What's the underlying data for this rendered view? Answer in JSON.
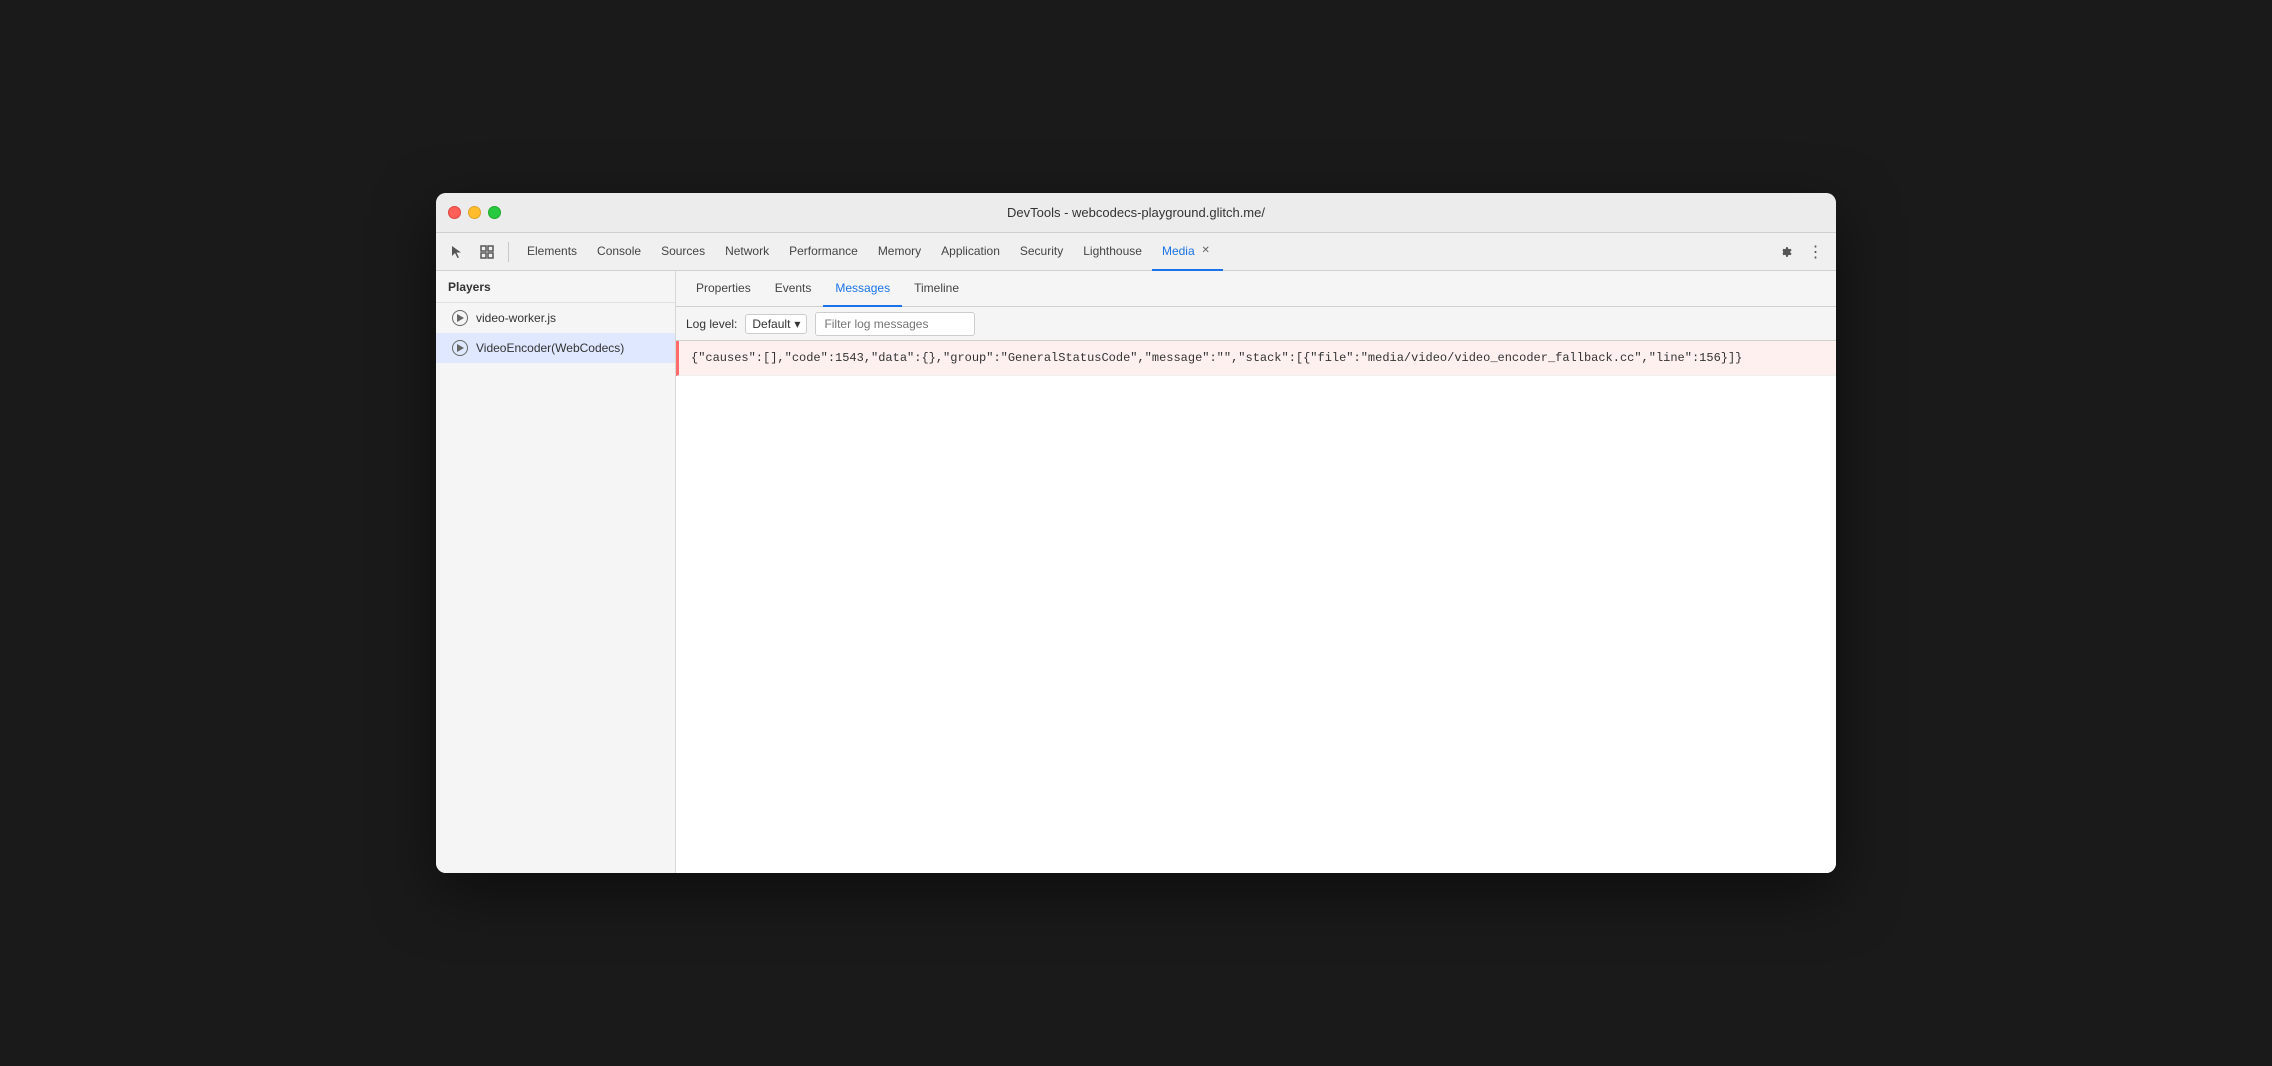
{
  "window": {
    "title": "DevTools - webcodecs-playground.glitch.me/"
  },
  "traffic_lights": {
    "red_label": "close",
    "yellow_label": "minimize",
    "green_label": "maximize"
  },
  "toolbar": {
    "cursor_icon": "⬚",
    "inspect_icon": "▣",
    "tabs": [
      {
        "id": "elements",
        "label": "Elements",
        "active": false
      },
      {
        "id": "console",
        "label": "Console",
        "active": false
      },
      {
        "id": "sources",
        "label": "Sources",
        "active": false
      },
      {
        "id": "network",
        "label": "Network",
        "active": false
      },
      {
        "id": "performance",
        "label": "Performance",
        "active": false
      },
      {
        "id": "memory",
        "label": "Memory",
        "active": false
      },
      {
        "id": "application",
        "label": "Application",
        "active": false
      },
      {
        "id": "security",
        "label": "Security",
        "active": false
      },
      {
        "id": "lighthouse",
        "label": "Lighthouse",
        "active": false
      },
      {
        "id": "media",
        "label": "Media",
        "active": true,
        "closable": true
      }
    ],
    "settings_icon": "⚙",
    "more_icon": "⋮"
  },
  "sidebar": {
    "header": "Players",
    "items": [
      {
        "id": "video-worker",
        "label": "video-worker.js",
        "selected": false
      },
      {
        "id": "video-encoder",
        "label": "VideoEncoder(WebCodecs)",
        "selected": true
      }
    ]
  },
  "panel": {
    "sub_tabs": [
      {
        "id": "properties",
        "label": "Properties",
        "active": false
      },
      {
        "id": "events",
        "label": "Events",
        "active": false
      },
      {
        "id": "messages",
        "label": "Messages",
        "active": true
      },
      {
        "id": "timeline",
        "label": "Timeline",
        "active": false
      }
    ],
    "log_controls": {
      "label": "Log level:",
      "level": "Default",
      "dropdown_icon": "▾",
      "filter_placeholder": "Filter log messages"
    },
    "log_entries": [
      {
        "id": "entry-1",
        "type": "error",
        "text": "{\"causes\":[],\"code\":1543,\"data\":{},\"group\":\"GeneralStatusCode\",\"message\":\"\",\"stack\":[{\"file\":\"media/video/video_encoder_fallback.cc\",\"line\":156}]}"
      }
    ]
  }
}
